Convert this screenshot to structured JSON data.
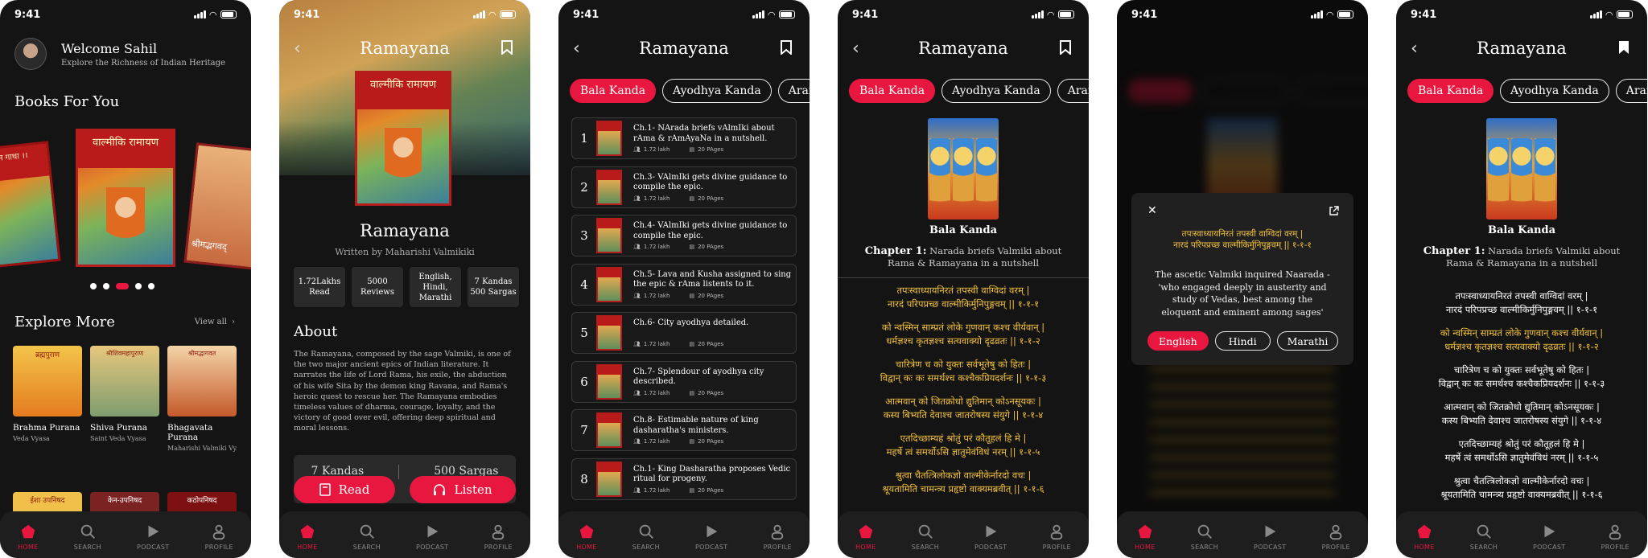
{
  "status": {
    "time": "9:41"
  },
  "nav": [
    {
      "label": "HOME",
      "icon": "home-icon"
    },
    {
      "label": "SEARCH",
      "icon": "search-icon"
    },
    {
      "label": "PODCAST",
      "icon": "play-icon"
    },
    {
      "label": "PROFILE",
      "icon": "profile-icon"
    }
  ],
  "home": {
    "welcome": "Welcome Sahil",
    "subtitle": "Explore the Richness of Indian Heritage",
    "books_heading": "Books For You",
    "carousel": [
      "राम गाथा ।।",
      "वाल्मीकि रामायण",
      "श्रीमद्भगवद्"
    ],
    "explore_heading": "Explore More",
    "view_all": "View all",
    "cards": [
      {
        "title": "Brahma Purana",
        "author": "Veda Vyasa",
        "cover": "ब्रह्मपुराण"
      },
      {
        "title": "Shiva Purana",
        "author": "Saint Veda Vyasa",
        "cover": "श्रीशिवमहापुराण"
      },
      {
        "title": "Bhagavata Purana",
        "author": "Maharishi Valmiki Vy...",
        "cover": "श्रीमद्भागवत"
      }
    ],
    "row2": [
      "ईशा उपनिषद",
      "केन-उपनिषद",
      "कठोपनिषद"
    ]
  },
  "detail": {
    "title": "Ramayana",
    "cover_text": "वाल्मीकि रामायण",
    "book_title": "Ramayana",
    "author": "Written by Maharishi Valmikiki",
    "stats": [
      {
        "l1": "1.72Lakhs",
        "l2": "Read",
        "l3": ""
      },
      {
        "l1": "5000",
        "l2": "Reviews",
        "l3": ""
      },
      {
        "l1": "English,",
        "l2": "Hindi,",
        "l3": "Marathi"
      },
      {
        "l1": "7 Kandas",
        "l2": "500 Sargas",
        "l3": ""
      }
    ],
    "about_heading": "About",
    "about": "The Ramayana, composed by the sage Valmiki, is one of the two major ancient epics of Indian literature. It narrates the life of Lord Rama, his exile, the abduction of his wife Sita by the demon king Ravana, and Rama's heroic quest to rescue her. The Ramayana embodies timeless values of dharma, courage, loyalty, and the victory of good over evil, offering deep spiritual and moral lessons.",
    "kandas": "7 Kandas",
    "sargas": "500 Sargas",
    "read": "Read",
    "listen": "Listen"
  },
  "chapters_screen": {
    "title": "Ramayana",
    "chips": [
      "Bala Kanda",
      "Ayodhya Kanda",
      "Aranya K"
    ],
    "chapters": [
      {
        "num": "1",
        "title": "Ch.1- NArada briefs vAlmIki about rAma & rAmAyaNa in a nutshell.",
        "reads": "1.72 lakh",
        "pages": "20 PAges"
      },
      {
        "num": "2",
        "title": "Ch.3- VAlmIki gets divine guidance to compile the epic.",
        "reads": "1.72 lakh",
        "pages": "20 PAges"
      },
      {
        "num": "3",
        "title": "Ch.4- VAlmIki gets divine guidance to compile the epic.",
        "reads": "1.72 lakh",
        "pages": "20 PAges"
      },
      {
        "num": "4",
        "title": "Ch.5- Lava and Kusha assigned to sing the epic & rAma listents to it.",
        "reads": "1.72 lakh",
        "pages": "20 PAges"
      },
      {
        "num": "5",
        "title": "Ch.6- City ayodhya detailed.",
        "reads": "1.72 lakh",
        "pages": "20 PAges"
      },
      {
        "num": "6",
        "title": "Ch.7- Splendour of ayodhya city described.",
        "reads": "1.72 lakh",
        "pages": "20 PAges"
      },
      {
        "num": "7",
        "title": "Ch.8- Estimable nature of king dasharatha's ministers.",
        "reads": "1.72 lakh",
        "pages": "20 PAges"
      },
      {
        "num": "8",
        "title": "Ch.1- King Dasharatha proposes Vedic ritual for progeny.",
        "reads": "1.72 lakh",
        "pages": "20 PAges"
      }
    ]
  },
  "reader": {
    "title": "Ramayana",
    "chips": [
      "Bala Kanda",
      "Ayodhya Kanda",
      "Aranya K"
    ],
    "kanda": "Bala Kanda",
    "chapter_label": "Chapter 1:",
    "chapter_desc": "Narada briefs Valmiki about Rama & Ramayana in a nutshell",
    "verses": [
      [
        "तपःस्वाध्यायनिरतं तपस्वी वाग्विदां वरम् |",
        "नारदं परिपप्रच्छ वाल्मीकिर्मुनिपुङ्गवम् || १-१-१"
      ],
      [
        "को न्वस्मिन् साम्प्रतं लोके गुणवान् कश्च वीर्यवान् |",
        "धर्मज्ञश्च कृतज्ञश्च सत्यवाक्यो दृढव्रतः || १-१-२"
      ],
      [
        "चारित्रेण च को युक्तः सर्वभूतेषु को हितः |",
        "विद्वान् कः कः समर्थश्च कश्चैकप्रियदर्शनः || १-१-३"
      ],
      [
        "आत्मवान् को जितक्रोधो द्युतिमान् कोऽनसूयकः |",
        "कस्य बिभ्यति देवाश्च जातरोषस्य संयुगे || १-१-४"
      ],
      [
        "एतदिच्छाम्यहं श्रोतुं परं कौतूहलं हि मे |",
        "महर्षे त्वं समर्थोऽसि ज्ञातुमेवंविधं नरम् || १-१-५"
      ],
      [
        "श्रुत्वा चैतत्त्रिलोकज्ञो वाल्मीकेर्नारदो वचः |",
        "श्रूयतामिति चामन्त्र्य प्रहृष्टो वाक्यमब्रवीत् || १-१-६"
      ]
    ]
  },
  "translation_popup": {
    "verse_l1": "तपःस्वाध्यायनिरतं तपस्वी वाग्विदां वरम् |",
    "verse_l2": "नारदं परिपप्रच्छ वाल्मीकिर्मुनिपुङ्गवम् || १-१-१",
    "text": "The ascetic Valmiki inquired Naarada - 'who engaged deeply in austerity and study of Vedas, best among the eloquent and eminent among sages'",
    "langs": [
      "English",
      "Hindi",
      "Marathi"
    ]
  },
  "colors": {
    "accent": "#e8173f",
    "verse_yellow": "#f3c23e",
    "bg": "#141414"
  }
}
